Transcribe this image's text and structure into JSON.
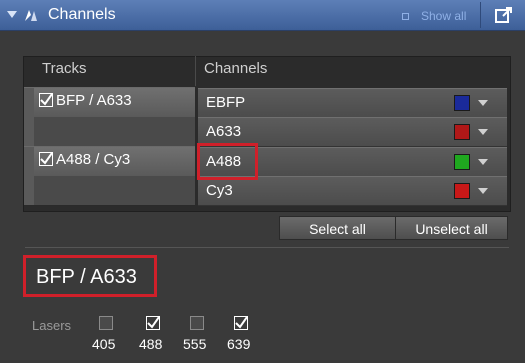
{
  "header": {
    "title": "Channels",
    "show_all_label": "Show all"
  },
  "columns": {
    "tracks": "Tracks",
    "channels": "Channels"
  },
  "tracks": [
    {
      "label": "BFP / A633",
      "checked": true
    },
    {
      "label": "A488 / Cy3",
      "checked": true
    }
  ],
  "channels": [
    {
      "name": "EBFP",
      "color": "#1a2a9a"
    },
    {
      "name": "A633",
      "color": "#b01818"
    },
    {
      "name": "A488",
      "color": "#1fa81f"
    },
    {
      "name": "Cy3",
      "color": "#c81818"
    }
  ],
  "buttons": {
    "select_all": "Select all",
    "unselect_all": "Unselect all"
  },
  "selected_track_label": "BFP / A633",
  "lasers": {
    "label": "Lasers",
    "items": [
      {
        "wavelength": "405",
        "checked": false
      },
      {
        "wavelength": "488",
        "checked": true
      },
      {
        "wavelength": "555",
        "checked": false
      },
      {
        "wavelength": "639",
        "checked": true
      }
    ]
  },
  "colors": {
    "header_blue": "#4a6ca8",
    "highlight_red": "#d0202a",
    "background": "#3a3a3a"
  }
}
